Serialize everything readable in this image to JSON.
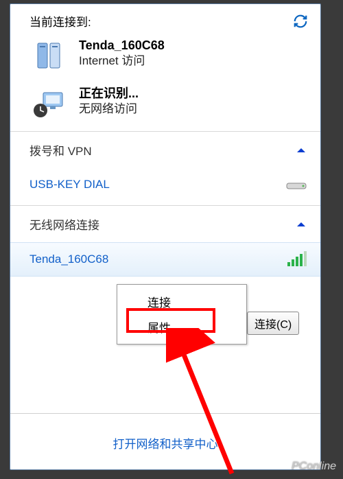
{
  "header": {
    "title": "当前连接到:"
  },
  "connections": [
    {
      "name": "Tenda_160C68",
      "status": "Internet 访问",
      "icon": "server"
    },
    {
      "name": "正在识别...",
      "status": "无网络访问",
      "icon": "network-unknown"
    }
  ],
  "sections": {
    "vpn": {
      "title": "拨号和 VPN",
      "items": [
        {
          "label": "USB-KEY DIAL"
        }
      ]
    },
    "wifi": {
      "title": "无线网络连接",
      "items": [
        {
          "ssid": "Tenda_160C68",
          "signal": 4
        }
      ]
    }
  },
  "context_menu": {
    "items": [
      "连接",
      "属性"
    ],
    "highlighted": "属性"
  },
  "connect_button": "连接(C)",
  "footer_link": "打开网络和共享中心",
  "watermark": "PConline"
}
